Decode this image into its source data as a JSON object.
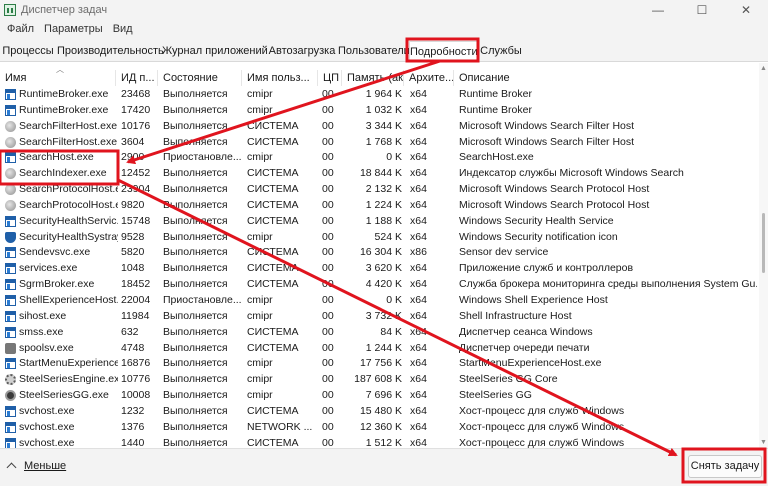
{
  "window": {
    "title": "Диспетчер задач",
    "controls": [
      "—",
      "☐",
      "✕"
    ]
  },
  "menu": [
    "Файл",
    "Параметры",
    "Вид"
  ],
  "tabs": [
    {
      "label": "Процессы",
      "active": false
    },
    {
      "label": "Производительность",
      "active": false
    },
    {
      "label": "Журнал приложений",
      "active": false
    },
    {
      "label": "Автозагрузка",
      "active": false
    },
    {
      "label": "Пользователи",
      "active": false
    },
    {
      "label": "Подробности",
      "active": true
    },
    {
      "label": "Службы",
      "active": false
    }
  ],
  "columns": [
    "Имя",
    "ИД п...",
    "Состояние",
    "Имя польз...",
    "ЦП",
    "Память (ак...",
    "Архите...",
    "Описание"
  ],
  "rows": [
    {
      "name": "RuntimeBroker.exe",
      "icon": "window-icon",
      "pid": "23468",
      "status": "Выполняется",
      "user": "cmipr",
      "cpu": "00",
      "mem": "1 964 K",
      "arch": "x64",
      "desc": "Runtime Broker"
    },
    {
      "name": "RuntimeBroker.exe",
      "icon": "window-icon",
      "pid": "17420",
      "status": "Выполняется",
      "user": "cmipr",
      "cpu": "00",
      "mem": "1 032 K",
      "arch": "x64",
      "desc": "Runtime Broker"
    },
    {
      "name": "SearchFilterHost.exe",
      "icon": "search-icon",
      "pid": "10176",
      "status": "Выполняется",
      "user": "СИСТЕМА",
      "cpu": "00",
      "mem": "3 344 K",
      "arch": "x64",
      "desc": "Microsoft Windows Search Filter Host"
    },
    {
      "name": "SearchFilterHost.exe",
      "icon": "search-icon",
      "pid": "3604",
      "status": "Выполняется",
      "user": "СИСТЕМА",
      "cpu": "00",
      "mem": "1 768 K",
      "arch": "x64",
      "desc": "Microsoft Windows Search Filter Host"
    },
    {
      "name": "SearchHost.exe",
      "icon": "window-icon",
      "pid": "2900",
      "status": "Приостановле...",
      "user": "cmipr",
      "cpu": "00",
      "mem": "0 K",
      "arch": "x64",
      "desc": "SearchHost.exe"
    },
    {
      "name": "SearchIndexer.exe",
      "icon": "search-icon",
      "pid": "12452",
      "status": "Выполняется",
      "user": "СИСТЕМА",
      "cpu": "00",
      "mem": "18 844 K",
      "arch": "x64",
      "desc": "Индексатор службы Microsoft Windows Search"
    },
    {
      "name": "SearchProtocolHost.e...",
      "icon": "search-icon",
      "pid": "23904",
      "status": "Выполняется",
      "user": "СИСТЕМА",
      "cpu": "00",
      "mem": "2 132 K",
      "arch": "x64",
      "desc": "Microsoft Windows Search Protocol Host"
    },
    {
      "name": "SearchProtocolHost.e...",
      "icon": "search-icon",
      "pid": "9820",
      "status": "Выполняется",
      "user": "СИСТЕМА",
      "cpu": "00",
      "mem": "1 224 K",
      "arch": "x64",
      "desc": "Microsoft Windows Search Protocol Host"
    },
    {
      "name": "SecurityHealthServic...",
      "icon": "window-icon",
      "pid": "15748",
      "status": "Выполняется",
      "user": "СИСТЕМА",
      "cpu": "00",
      "mem": "1 188 K",
      "arch": "x64",
      "desc": "Windows Security Health Service"
    },
    {
      "name": "SecurityHealthSystray...",
      "icon": "shield-icon",
      "pid": "9528",
      "status": "Выполняется",
      "user": "cmipr",
      "cpu": "00",
      "mem": "524 K",
      "arch": "x64",
      "desc": "Windows Security notification icon"
    },
    {
      "name": "Sendevsvc.exe",
      "icon": "window-icon",
      "pid": "5820",
      "status": "Выполняется",
      "user": "СИСТЕМА",
      "cpu": "00",
      "mem": "16 304 K",
      "arch": "x86",
      "desc": "Sensor dev service"
    },
    {
      "name": "services.exe",
      "icon": "window-icon",
      "pid": "1048",
      "status": "Выполняется",
      "user": "СИСТЕМА",
      "cpu": "00",
      "mem": "3 620 K",
      "arch": "x64",
      "desc": "Приложение служб и контроллеров"
    },
    {
      "name": "SgrmBroker.exe",
      "icon": "window-icon",
      "pid": "18452",
      "status": "Выполняется",
      "user": "СИСТЕМА",
      "cpu": "00",
      "mem": "4 420 K",
      "arch": "x64",
      "desc": "Служба брокера мониторинга среды выполнения System Gu..."
    },
    {
      "name": "ShellExperienceHost....",
      "icon": "window-icon",
      "pid": "22004",
      "status": "Приостановле...",
      "user": "cmipr",
      "cpu": "00",
      "mem": "0 K",
      "arch": "x64",
      "desc": "Windows Shell Experience Host"
    },
    {
      "name": "sihost.exe",
      "icon": "window-icon",
      "pid": "11984",
      "status": "Выполняется",
      "user": "cmipr",
      "cpu": "00",
      "mem": "3 732 K",
      "arch": "x64",
      "desc": "Shell Infrastructure Host"
    },
    {
      "name": "smss.exe",
      "icon": "window-icon",
      "pid": "632",
      "status": "Выполняется",
      "user": "СИСТЕМА",
      "cpu": "00",
      "mem": "84 K",
      "arch": "x64",
      "desc": "Диспетчер сеанса  Windows"
    },
    {
      "name": "spoolsv.exe",
      "icon": "printer-icon",
      "pid": "4748",
      "status": "Выполняется",
      "user": "СИСТЕМА",
      "cpu": "00",
      "mem": "1 244 K",
      "arch": "x64",
      "desc": "Диспетчер очереди печати"
    },
    {
      "name": "StartMenuExperience...",
      "icon": "window-icon",
      "pid": "16876",
      "status": "Выполняется",
      "user": "cmipr",
      "cpu": "00",
      "mem": "17 756 K",
      "arch": "x64",
      "desc": "StartMenuExperienceHost.exe"
    },
    {
      "name": "SteelSeriesEngine.exe",
      "icon": "gear-icon",
      "pid": "10776",
      "status": "Выполняется",
      "user": "cmipr",
      "cpu": "00",
      "mem": "187 608 K",
      "arch": "x64",
      "desc": "SteelSeries GG Core"
    },
    {
      "name": "SteelSeriesGG.exe",
      "icon": "steelseries-icon",
      "pid": "10008",
      "status": "Выполняется",
      "user": "cmipr",
      "cpu": "00",
      "mem": "7 696 K",
      "arch": "x64",
      "desc": "SteelSeries GG"
    },
    {
      "name": "svchost.exe",
      "icon": "window-icon",
      "pid": "1232",
      "status": "Выполняется",
      "user": "СИСТЕМА",
      "cpu": "00",
      "mem": "15 480 K",
      "arch": "x64",
      "desc": "Хост-процесс для служб Windows"
    },
    {
      "name": "svchost.exe",
      "icon": "window-icon",
      "pid": "1376",
      "status": "Выполняется",
      "user": "NETWORK ...",
      "cpu": "00",
      "mem": "12 360 K",
      "arch": "x64",
      "desc": "Хост-процесс для служб Windows"
    },
    {
      "name": "svchost.exe",
      "icon": "window-icon",
      "pid": "1440",
      "status": "Выполняется",
      "user": "СИСТЕМА",
      "cpu": "00",
      "mem": "1 512 K",
      "arch": "x64",
      "desc": "Хост-процесс для служб Windows"
    }
  ],
  "footer": {
    "less_label": "Меньше",
    "end_task_label": "Снять задачу"
  },
  "annotation_color": "#e0141e"
}
